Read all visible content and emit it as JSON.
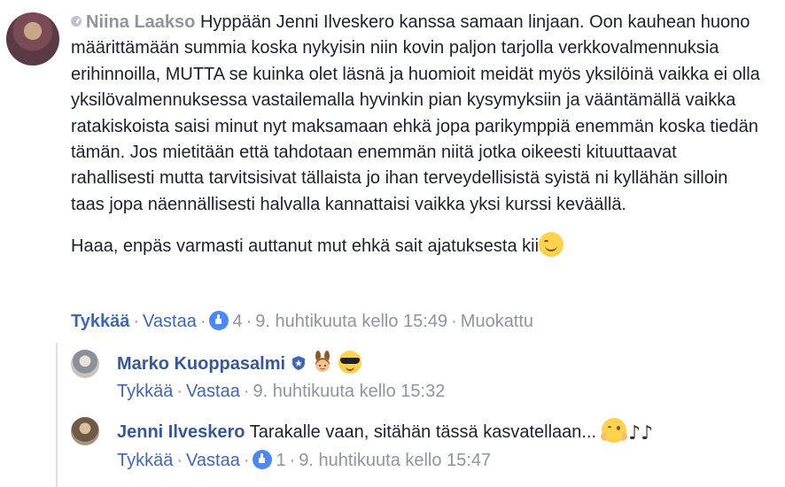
{
  "main_comment": {
    "author": "Niina Laakso",
    "text": "Hyppään Jenni Ilveskero kanssa samaan linjaan. Oon kauhean huono määrittämään summia koska nykyisin niin kovin paljon tarjolla verkkovalmennuksia erihinnoilla, MUTTA se kuinka olet läsnä ja huomioit meidät myös yksilöinä vaikka ei olla yksilövalmennuksessa vastailemalla hyvinkin pian kysymyksiin ja vääntämällä vaikka ratakiskoista saisi minut nyt maksamaan ehkä jopa parikymppiä enemmän koska tiedän tämän. Jos mietitään että tahdotaan enemmän niitä jotka oikeesti kituuttaavat rahallisesti mutta tarvitsisivat tällaista jo ihan terveydellisistä syistä ni kyllähän silloin taas jopa näennällisesti halvalla kannattaisi vaikka yksi kurssi keväällä.",
    "text2": "Haaa, enpäs varmasti auttanut mut ehkä sait ajatuksesta kii",
    "emoji": "smiling-face-icon",
    "actions": {
      "like": "Tykkää",
      "reply": "Vastaa",
      "like_count": "4",
      "timestamp": "9. huhtikuuta kello 15:49",
      "edited": "Muokattu"
    }
  },
  "replies": [
    {
      "author": "Marko Kuoppasalmi",
      "badge": "verified-shield-icon",
      "emojis": [
        "bunny-ears-icon",
        "sunglasses-face-icon"
      ],
      "actions": {
        "like": "Tykkää",
        "reply": "Vastaa",
        "timestamp": "9. huhtikuuta kello 15:32"
      }
    },
    {
      "author": "Jenni Ilveskero",
      "text": "Tarakalle vaan, sitähän tässä kasvatellaan...",
      "emojis": [
        "hugging-face-icon",
        "music-notes-icon"
      ],
      "actions": {
        "like": "Tykkää",
        "reply": "Vastaa",
        "like_count": "1",
        "timestamp": "9. huhtikuuta kello 15:47"
      }
    }
  ],
  "colors": {
    "link_blue": "#4267b2",
    "author_blue": "#365899",
    "meta_gray": "#90949c",
    "text": "#1d2129"
  }
}
